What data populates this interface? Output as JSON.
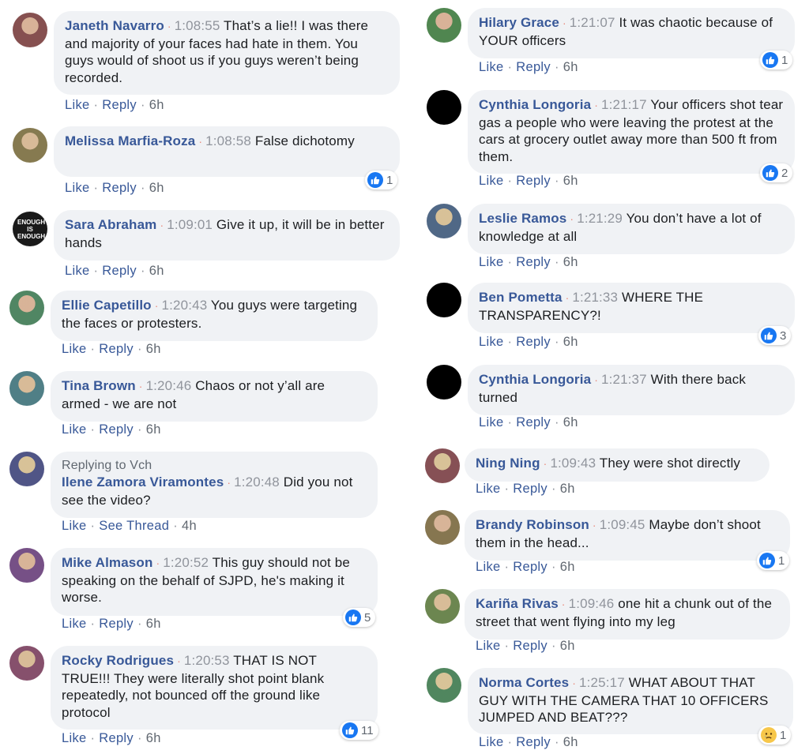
{
  "action_labels": {
    "like": "Like",
    "reply": "Reply",
    "see_thread": "See Thread"
  },
  "colors": {
    "author": "#385898",
    "bubble": "#f0f2f5",
    "like_blue": "#1877f2",
    "sad_yellow": "#f7c74a",
    "dot": "#e9897a"
  },
  "left_column": [
    {
      "author": "Janeth Navarro",
      "time": "1:08:55",
      "text": "That’s a lie!! I was there and majority of your faces had hate in them. You guys would of shoot us if you guys weren’t being recorded.",
      "age": "6h",
      "avatar_icon": "user-photo-avatar"
    },
    {
      "author": "Melissa Marfia-Roza",
      "time": "1:08:58",
      "text": "False dichotomy",
      "age": "6h",
      "reaction": {
        "icon": "like-icon",
        "count": "1"
      },
      "avatar_icon": "user-photo-avatar"
    },
    {
      "author": "Sara Abraham",
      "time": "1:09:01",
      "text": "Give it up, it will be in better hands",
      "age": "6h",
      "avatar_icon": "enough-is-enough-avatar",
      "avatar_text": "ENOUGH IS ENOUGH"
    },
    {
      "author": "Ellie Capetillo",
      "time": "1:20:43",
      "text": "You guys were targeting the faces or protesters.",
      "age": "6h",
      "avatar_icon": "user-photo-avatar"
    },
    {
      "author": "Tina Brown",
      "time": "1:20:46",
      "text": "Chaos or not y’all are armed - we are not",
      "age": "6h",
      "avatar_icon": "user-photo-avatar"
    },
    {
      "replying_to": "Replying to Vch",
      "author": "Ilene Zamora Viramontes",
      "time": "1:20:48",
      "text": "Did you not see the video?",
      "age": "4h",
      "second_action": "see_thread",
      "avatar_icon": "user-photo-avatar"
    },
    {
      "author": "Mike Almason",
      "time": "1:20:52",
      "text": "This guy should not be speaking on the behalf of SJPD, he's making it worse.",
      "age": "6h",
      "reaction": {
        "icon": "like-icon",
        "count": "5"
      },
      "avatar_icon": "user-photo-avatar"
    },
    {
      "author": "Rocky Rodrigues",
      "time": "1:20:53",
      "text": "THAT IS NOT TRUE!!! They were literally shot point blank repeatedly, not bounced off the ground like protocol",
      "age": "6h",
      "reaction": {
        "icon": "like-icon",
        "count": "11"
      },
      "avatar_icon": "user-photo-avatar"
    }
  ],
  "right_column": [
    {
      "author": "Hilary Grace",
      "time": "1:21:07",
      "text": "It was chaotic because of YOUR officers",
      "age": "6h",
      "reaction": {
        "icon": "like-icon",
        "count": "1"
      },
      "avatar_icon": "user-photo-avatar"
    },
    {
      "author": "Cynthia Longoria",
      "time": "1:21:17",
      "text": "Your officers shot tear gas a people who were leaving the protest at the cars at grocery outlet away more than 500 ft from them.",
      "age": "6h",
      "reaction": {
        "icon": "like-icon",
        "count": "2"
      },
      "avatar_icon": "blank-black-avatar"
    },
    {
      "author": "Leslie Ramos",
      "time": "1:21:29",
      "text": "You don’t have a lot of knowledge at all",
      "age": "6h",
      "avatar_icon": "user-photo-avatar"
    },
    {
      "author": "Ben Pometta",
      "time": "1:21:33",
      "text": "WHERE THE TRANSPARENCY?!",
      "age": "6h",
      "reaction": {
        "icon": "like-icon",
        "count": "3"
      },
      "avatar_icon": "blank-black-avatar"
    },
    {
      "author": "Cynthia Longoria",
      "time": "1:21:37",
      "text": "With there back turned",
      "age": "6h",
      "avatar_icon": "blank-black-avatar"
    },
    {
      "author": "Ning Ning",
      "time": "1:09:43",
      "text": "They were shot directly",
      "age": "6h",
      "avatar_icon": "user-photo-avatar"
    },
    {
      "author": "Brandy Robinson",
      "time": "1:09:45",
      "text": "Maybe don’t shoot them in the head...",
      "age": "6h",
      "reaction": {
        "icon": "like-icon",
        "count": "1"
      },
      "avatar_icon": "user-photo-avatar"
    },
    {
      "author": "Kariña Rivas",
      "time": "1:09:46",
      "text": "one hit a chunk out of the street that went flying into my leg",
      "age": "6h",
      "avatar_icon": "user-photo-avatar"
    },
    {
      "author": "Norma Cortes",
      "time": "1:25:17",
      "text": "WHAT ABOUT THAT GUY WITH THE CAMERA THAT 10 OFFICERS JUMPED AND BEAT???",
      "age": "6h",
      "reaction": {
        "icon": "sad-icon",
        "count": "1"
      },
      "avatar_icon": "user-photo-avatar"
    }
  ]
}
